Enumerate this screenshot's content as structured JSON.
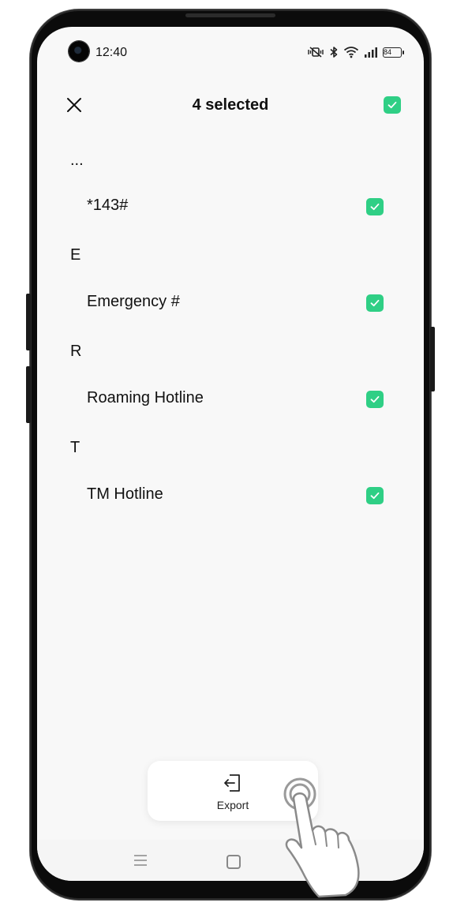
{
  "status_bar": {
    "time": "12:40",
    "battery": "84",
    "icons": [
      "vibrate-mute-icon",
      "bluetooth-icon",
      "wifi-icon",
      "signal-icon",
      "battery-icon"
    ]
  },
  "header": {
    "title": "4 selected",
    "close_icon": "close-icon",
    "select_all_checked": true
  },
  "sections": [
    {
      "letter": "...",
      "items": [
        {
          "label": "*143#",
          "checked": true
        }
      ]
    },
    {
      "letter": "E",
      "items": [
        {
          "label": "Emergency #",
          "checked": true
        }
      ]
    },
    {
      "letter": "R",
      "items": [
        {
          "label": "Roaming Hotline",
          "checked": true
        }
      ]
    },
    {
      "letter": "T",
      "items": [
        {
          "label": "TM Hotline",
          "checked": true
        }
      ]
    }
  ],
  "action_bar": {
    "export_label": "Export",
    "export_icon": "export-icon"
  },
  "nav_bar": {
    "icons": [
      "menu-icon",
      "home-icon"
    ]
  },
  "colors": {
    "accent": "#2fcf85",
    "background": "#f8f8f8",
    "frame": "#0b0b0b"
  }
}
